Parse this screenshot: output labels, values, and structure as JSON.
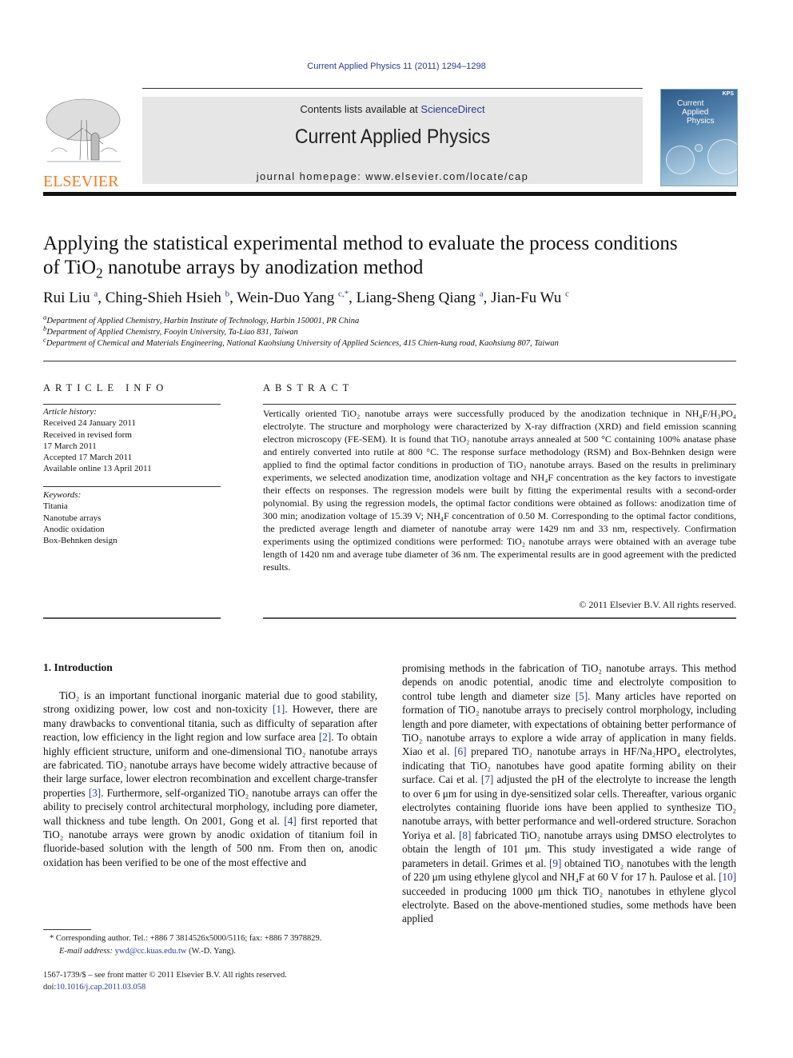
{
  "header": {
    "citation": "Current Applied Physics 11 (2011) 1294–1298",
    "publisher_logo_text": "ELSEVIER",
    "contents_prefix": "Contents lists available at ",
    "contents_link": "ScienceDirect",
    "journal_title": "Current Applied Physics",
    "homepage": "journal homepage: www.elsevier.com/locate/cap",
    "cover": {
      "title_lines": [
        "Current",
        "Applied",
        "Physics"
      ],
      "badge": "KPS"
    },
    "colors": {
      "logo_orange": "#f47b20",
      "link_blue": "#2b3a8f",
      "band_grey": "#e6e6e6"
    }
  },
  "article": {
    "title_line1": "Applying the statistical experimental method to evaluate the process conditions",
    "title_line2_pre": "of TiO",
    "title_line2_sub": "2",
    "title_line2_post": " nanotube arrays by anodization method",
    "authors": [
      {
        "name": "Rui Liu",
        "sup": "a"
      },
      {
        "name": "Ching-Shieh Hsieh",
        "sup": "b"
      },
      {
        "name": "Wein-Duo Yang",
        "sup": "c,*"
      },
      {
        "name": "Liang-Sheng Qiang",
        "sup": "a"
      },
      {
        "name": "Jian-Fu Wu",
        "sup": "c"
      }
    ],
    "affiliations": [
      {
        "key": "a",
        "text": "Department of Applied Chemistry, Harbin Institute of Technology, Harbin 150001, PR China"
      },
      {
        "key": "b",
        "text": "Department of Applied Chemistry, Fooyin University, Ta-Liao 831, Taiwan"
      },
      {
        "key": "c",
        "text": "Department of Chemical and Materials Engineering, National Kaohsiung University of Applied Sciences, 415 Chien-kung road, Kaohsiung 807, Taiwan"
      }
    ]
  },
  "article_info": {
    "heading": "ARTICLE INFO",
    "history_label": "Article history:",
    "history": [
      "Received 24 January 2011",
      "Received in revised form",
      "17 March 2011",
      "Accepted 17 March 2011",
      "Available online 13 April 2011"
    ],
    "keywords_label": "Keywords:",
    "keywords": [
      "Titania",
      "Nanotube arrays",
      "Anodic oxidation",
      "Box-Behnken design"
    ]
  },
  "abstract": {
    "heading": "ABSTRACT",
    "text": "Vertically oriented TiO₂ nanotube arrays were successfully produced by the anodization technique in NH₄F/H₃PO₄ electrolyte. The structure and morphology were characterized by X-ray diffraction (XRD) and field emission scanning electron microscopy (FE-SEM). It is found that TiO₂ nanotube arrays annealed at 500 °C containing 100% anatase phase and entirely converted into rutile at 800 °C. The response surface methodology (RSM) and Box-Behnken design were applied to find the optimal factor conditions in production of TiO₂ nanotube arrays. Based on the results in preliminary experiments, we selected anodization time, anodization voltage and NH₄F concentration as the key factors to investigate their effects on responses. The regression models were built by fitting the experimental results with a second-order polynomial. By using the regression models, the optimal factor conditions were obtained as follows: anodization time of 300 min; anodization voltage of 15.39 V; NH₄F concentration of 0.50 M. Corresponding to the optimal factor conditions, the predicted average length and diameter of nanotube array were 1429 nm and 33 nm, respectively. Confirmation experiments using the optimized conditions were performed: TiO₂ nanotube arrays were obtained with an average tube length of 1420 nm and average tube diameter of 36 nm. The experimental results are in good agreement with the predicted results.",
    "copyright": "© 2011 Elsevier B.V. All rights reserved."
  },
  "body": {
    "section_heading": "1.  Introduction",
    "col1_text": "TiO₂ is an important functional inorganic material due to good stability, strong oxidizing power, low cost and non-toxicity [1]. However, there are many drawbacks to conventional titania, such as difficulty of separation after reaction, low efficiency in the light region and low surface area [2]. To obtain highly efficient structure, uniform and one-dimensional TiO₂ nanotube arrays are fabricated. TiO₂ nanotube arrays have become widely attractive because of their large surface, lower electron recombination and excellent charge-transfer properties [3]. Furthermore, self-organized TiO₂ nanotube arrays can offer the ability to precisely control architectural morphology, including pore diameter, wall thickness and tube length. On 2001, Gong et al. [4] first reported that TiO₂ nanotube arrays were grown by anodic oxidation of titanium foil in fluoride-based solution with the length of 500 nm. From then on, anodic oxidation has been verified to be one of the most effective and",
    "col2_text": "promising methods in the fabrication of TiO₂ nanotube arrays. This method depends on anodic potential, anodic time and electrolyte composition to control tube length and diameter size [5]. Many articles have reported on formation of TiO₂ nanotube arrays to precisely control morphology, including length and pore diameter, with expectations of obtaining better performance of TiO₂ nanotube arrays to explore a wide array of application in many fields. Xiao et al. [6] prepared TiO₂ nanotube arrays in HF/Na₂HPO₄ electrolytes, indicating that TiO₂ nanotubes have good apatite forming ability on their surface. Cai et al. [7] adjusted the pH of the electrolyte to increase the length to over 6 μm for using in dye-sensitized solar cells. Thereafter, various organic electrolytes containing fluoride ions have been applied to synthesize TiO₂ nanotube arrays, with better performance and well-ordered structure. Sorachon Yoriya et al. [8] fabricated TiO₂ nanotube arrays using DMSO electrolytes to obtain the length of 101 μm. This study investigated a wide range of parameters in detail. Grimes et al. [9] obtained TiO₂ nanotubes with the length of 220 μm using ethylene glycol and NH₄F at 60 V for 17 h. Paulose et al. [10] succeeded in producing 1000 μm thick TiO₂ nanotubes in ethylene glycol electrolyte. Based on the above-mentioned studies, some methods have been applied"
  },
  "footnote": {
    "corresponding": "* Corresponding author. Tel.: +886 7 3814526x5000/5116; fax: +886 7 3978829.",
    "email_label": "E-mail address: ",
    "email": "ywd@cc.kuas.edu.tw",
    "email_suffix": " (W.-D. Yang).",
    "front_matter": "1567-1739/$ – see front matter © 2011 Elsevier B.V. All rights reserved.",
    "doi_label": "doi:",
    "doi": "10.1016/j.cap.2011.03.058"
  }
}
